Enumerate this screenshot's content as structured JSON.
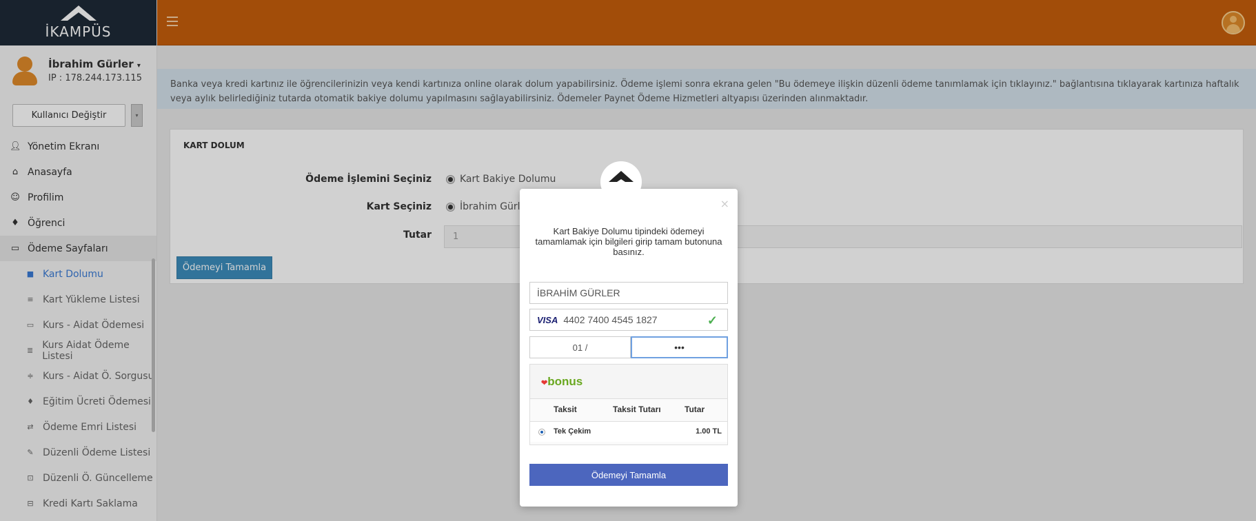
{
  "app": {
    "logo_text": "İKAMPÜS"
  },
  "user": {
    "name": "İbrahim Gürler",
    "ip": "IP : 178.244.173.115",
    "switch_label": "Kullanıcı Değiştir"
  },
  "sidebar": {
    "items": [
      {
        "label": "Yönetim Ekranı",
        "icon": "user-icon"
      },
      {
        "label": "Anasayfa",
        "icon": "home-icon"
      },
      {
        "label": "Profilim",
        "icon": "profile-icon"
      },
      {
        "label": "Öğrenci",
        "icon": "graduation-cap-icon"
      },
      {
        "label": "Ödeme Sayfaları",
        "icon": "credit-card-icon"
      }
    ],
    "sub_items": [
      {
        "label": "Kart Dolumu",
        "icon": "card-icon"
      },
      {
        "label": "Kart Yükleme Listesi",
        "icon": "list-icon"
      },
      {
        "label": "Kurs - Aidat Ödemesi",
        "icon": "monitor-icon"
      },
      {
        "label": "Kurs Aidat Ödeme Listesi",
        "icon": "list-icon"
      },
      {
        "label": "Kurs - Aidat Ö. Sorgusu",
        "icon": "filter-icon"
      },
      {
        "label": "Eğitim Ücreti Ödemesi",
        "icon": "graduation-cap-icon"
      },
      {
        "label": "Ödeme Emri Listesi",
        "icon": "exchange-icon"
      },
      {
        "label": "Düzenli Ödeme Listesi",
        "icon": "pencil-icon"
      },
      {
        "label": "Düzenli Ö. Güncelleme",
        "icon": "edit-box-icon"
      },
      {
        "label": "Kredi Kartı Saklama",
        "icon": "briefcase-icon"
      }
    ]
  },
  "alert": {
    "text": "Banka veya kredi kartınız ile öğrencilerinizin veya kendi kartınıza online olarak dolum yapabilirsiniz. Ödeme işlemi sonra ekrana gelen \"Bu ödemeye ilişkin düzenli ödeme tanımlamak için tıklayınız.\" bağlantısına tıklayarak kartınıza haftalık veya aylık belirlediğiniz tutarda otomatik bakiye dolumu yapılmasını sağlayabilirsiniz. Ödemeler Paynet Ödeme Hizmetleri altyapısı üzerinden alınmaktadır."
  },
  "panel": {
    "title": "KART DOLUM",
    "operation_label": "Ödeme İşlemini Seçiniz",
    "operation_value": "Kart Bakiye Dolumu",
    "card_label": "Kart Seçiniz",
    "card_value": "İbrahim Gürle",
    "amount_label": "Tutar",
    "amount_value": "1",
    "submit_label": "Ödemeyi Tamamla"
  },
  "modal": {
    "close": "×",
    "description": "Kart Bakiye Dolumu tipindeki ödemeyi tamamlamak için bilgileri girip tamam butonuna basınız.",
    "holder_name": "İBRAHİM GÜRLER",
    "card_brand": "VISA",
    "card_number": "4402 7400 4545 1827",
    "exp_month": "01 /",
    "cvv": "•••",
    "bonus_label": "bonus",
    "table_headers": [
      "Taksit",
      "Taksit Tutarı",
      "Tutar"
    ],
    "installment": {
      "name": "Tek Çekim",
      "per_installment": "",
      "total": "1.00 TL"
    },
    "submit_label": "Ödemeyi Tamamla"
  },
  "colors": {
    "topbar": "#c65f0c",
    "sidebar_dark": "#1e2a38",
    "active_menu": "#3a7bd5",
    "primary_button": "#3c8dbc",
    "modal_button": "#4c66be"
  }
}
